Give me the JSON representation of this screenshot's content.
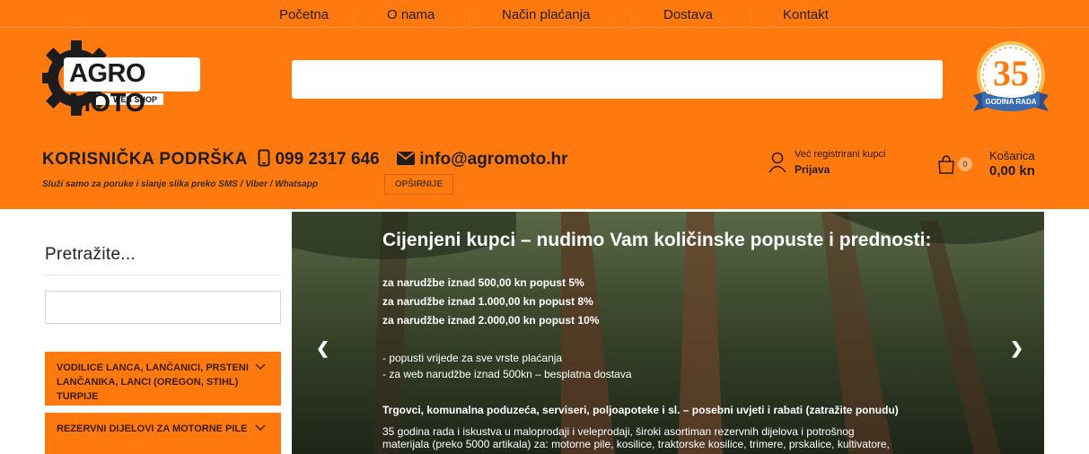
{
  "nav": {
    "items": [
      "Početna",
      "O nama",
      "Način plaćanja",
      "Dostava",
      "Kontakt"
    ]
  },
  "logo": {
    "title": "AGRO MOTO",
    "subtitle": "WEB SHOP"
  },
  "badge": {
    "number": "35",
    "text": "GODINA RADA"
  },
  "support": {
    "label": "KORISNIČKA PODRŠKA",
    "phone": "099 2317 646",
    "email": "info@agromoto.hr",
    "note": "Služi samo za poruke i slanje slika preko SMS / Viber / Whatsapp",
    "more_button": "OPŠIRNIJE"
  },
  "login": {
    "label": "Već registrirani kupci",
    "link": "Prijava"
  },
  "cart": {
    "count": "0",
    "label": "Košarica",
    "total": "0,00 kn"
  },
  "sidebar": {
    "title": "Pretražite...",
    "categories": [
      "VODILICE LANCA, LANČANICI, PRSTENI LANČANIKA, LANCI (OREGON, STIHL) TURPIJE",
      "REZERVNI DIJELOVI ZA MOTORNE PILE"
    ]
  },
  "slider": {
    "heading": "Cijenjeni kupci – nudimo Vam količinske popuste i prednosti:",
    "discounts": [
      "za narudžbe iznad 500,00 kn popust 5%",
      "za narudžbe iznad 1.000,00 kn popust 8%",
      "za narudžbe iznad 2.000,00 kn popust 10%"
    ],
    "benefits": [
      "- popusti vrijede za sve vrste plaćanja",
      "- za web narudžbe iznad 500kn – besplatna dostava"
    ],
    "business": "Trgovci, komunalna poduzeća, serviseri, poljoapoteke i sl. – posebni uvjeti i rabati (zatražite ponudu)",
    "about_1": "35 godina rada i iskustva u maloprodaji i veleprodaji, široki asortiman rezervnih dijelova i potrošnog",
    "about_2": "materijala (preko 5000 artikala) za: motorne pile, kosilice, traktorske kosilice, trimere, prskalice, kultivatore,"
  }
}
